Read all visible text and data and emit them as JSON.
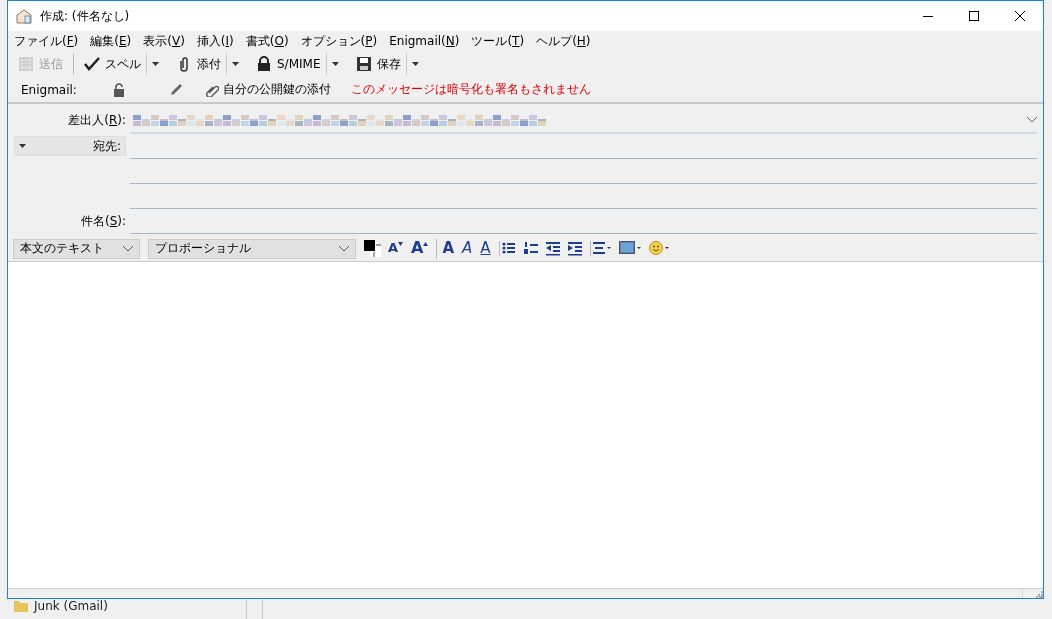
{
  "window": {
    "title": "作成: (件名なし)"
  },
  "menu": [
    {
      "before": "ファイル(",
      "accel": "F",
      "after": ")"
    },
    {
      "before": "編集(",
      "accel": "E",
      "after": ")"
    },
    {
      "before": "表示(",
      "accel": "V",
      "after": ")"
    },
    {
      "before": "挿入(",
      "accel": "I",
      "after": ")"
    },
    {
      "before": "書式(",
      "accel": "O",
      "after": ")"
    },
    {
      "before": "オプション(",
      "accel": "P",
      "after": ")"
    },
    {
      "before": "Enigmail(",
      "accel": "N",
      "after": ")"
    },
    {
      "before": "ツール(",
      "accel": "T",
      "after": ")"
    },
    {
      "before": "ヘルプ(",
      "accel": "H",
      "after": ")"
    }
  ],
  "toolbar": [
    {
      "kind": "send",
      "label": "送信",
      "disabled": true,
      "dropdown": false
    },
    {
      "kind": "spell",
      "label": "スペル",
      "disabled": false,
      "dropdown": true
    },
    {
      "kind": "attach",
      "label": "添付",
      "disabled": false,
      "dropdown": true
    },
    {
      "kind": "smime",
      "label": "S/MIME",
      "disabled": false,
      "dropdown": true
    },
    {
      "kind": "save",
      "label": "保存",
      "disabled": false,
      "dropdown": true
    }
  ],
  "enigmail": {
    "label": "Enigmail:",
    "encrypted": false,
    "attach_key": "自分の公開鍵の添付",
    "status": "このメッセージは暗号化も署名もされません"
  },
  "headers": {
    "from": {
      "before": "差出人(",
      "accel": "R",
      "after": "):"
    },
    "to": {
      "label": "宛先:"
    },
    "subject": {
      "before": "件名(",
      "accel": "S",
      "after": "):"
    }
  },
  "format": {
    "paragraph": "本文のテキスト",
    "font": "プロポーショナル",
    "buttons": [
      {
        "kind": "smaller",
        "glyph": "A",
        "sep": false
      },
      {
        "kind": "larger",
        "glyph": "A",
        "sep": false
      },
      {
        "kind": "bold",
        "glyph": "A",
        "sep": true
      },
      {
        "kind": "italic",
        "glyph": "A",
        "sep": false
      },
      {
        "kind": "underline",
        "glyph": "A",
        "sep": false
      },
      {
        "kind": "bullets",
        "sep": true
      },
      {
        "kind": "numbers",
        "sep": false
      },
      {
        "kind": "outdent",
        "sep": false
      },
      {
        "kind": "indent",
        "sep": false
      },
      {
        "kind": "align",
        "sep": true
      },
      {
        "kind": "image",
        "sep": false
      },
      {
        "kind": "emoji",
        "sep": false
      }
    ]
  },
  "background": {
    "folder": "Junk (Gmail)"
  }
}
